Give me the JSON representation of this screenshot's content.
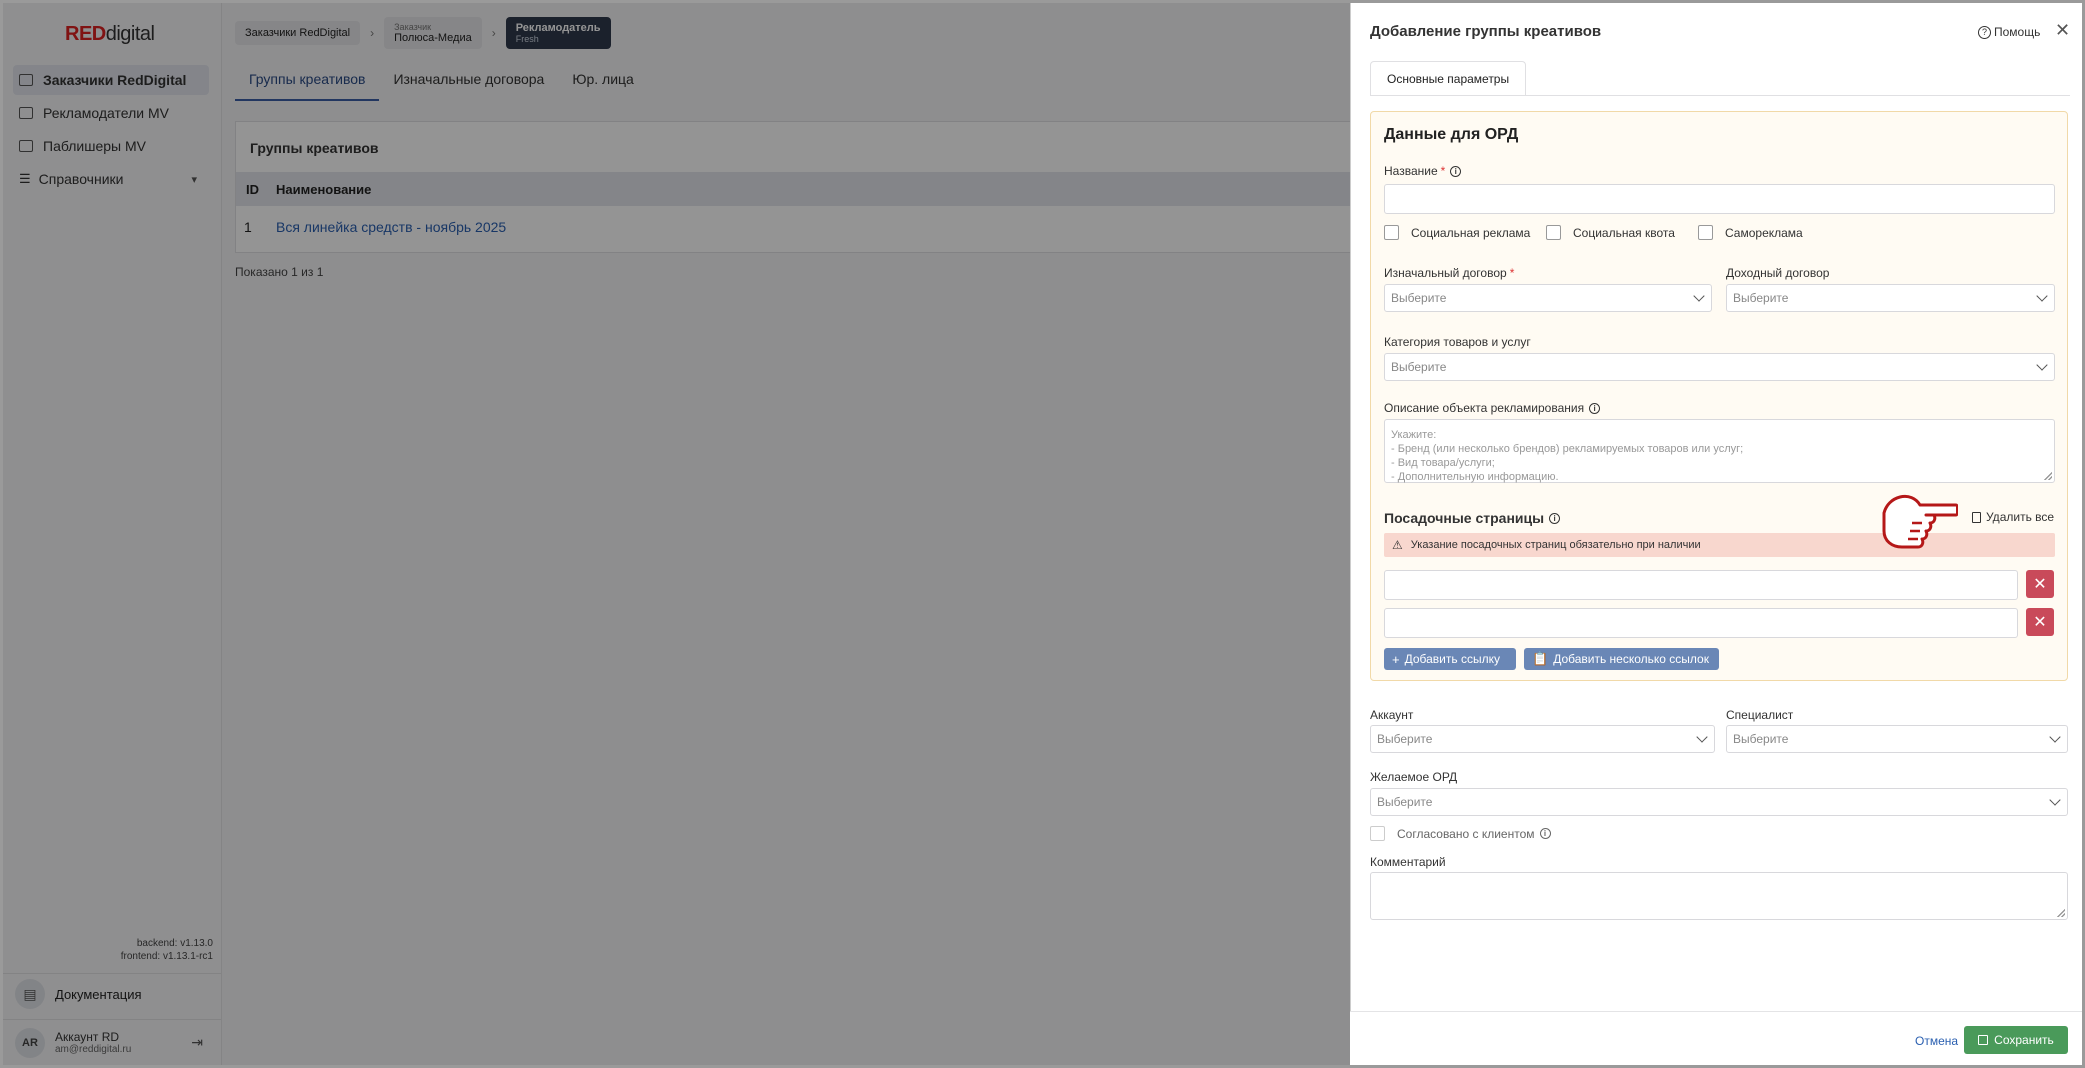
{
  "brand": {
    "red": "RED",
    "rest": "digital",
    "accent": "#dd2222"
  },
  "sidebar": {
    "items": [
      {
        "label": "Заказчики RedDigital",
        "icon": "id-card-icon"
      },
      {
        "label": "Рекламодатели MV",
        "icon": "id-card-icon"
      },
      {
        "label": "Паблишеры MV",
        "icon": "id-card-icon"
      },
      {
        "label": "Справочники",
        "icon": "list-icon"
      }
    ],
    "backend_version": "backend: v1.13.0",
    "frontend_version": "frontend: v1.13.1-rc1",
    "docs_label": "Документация",
    "user": {
      "initials": "AR",
      "name": "Аккаунт RD",
      "email": "am@reddigital.ru"
    }
  },
  "breadcrumbs": {
    "first": "Заказчики RedDigital",
    "second_caption": "Заказчик",
    "second_value": "Полюса-Медиа",
    "third_caption": "Рекламодатель",
    "third_value": "Fresh"
  },
  "tabs": [
    "Группы креативов",
    "Изначальные договора",
    "Юр. лица"
  ],
  "table": {
    "title": "Группы креативов",
    "columns": [
      "ID",
      "Наименование"
    ],
    "rows": [
      {
        "id": "1",
        "name": "Вся линейка средств - ноябрь 2025"
      }
    ],
    "shown": "Показано 1 из 1"
  },
  "drawer": {
    "title": "Добавление группы креативов",
    "help": "Помощь",
    "tab": "Основные параметры",
    "ord": {
      "title": "Данные для ОРД",
      "name_label": "Название",
      "checkboxes": [
        "Социальная реклама",
        "Социальная квота",
        "Самореклама"
      ],
      "initial_contract_label": "Изначальный договор",
      "income_contract_label": "Доходный договор",
      "category_label": "Категория товаров и услуг",
      "select_placeholder": "Выберите",
      "description_label": "Описание объекта рекламирования",
      "description_placeholder": "Укажите:\n- Бренд (или несколько брендов) рекламируемых товаров или услуг;\n- Вид товара/услуги;\n- Дополнительную информацию.",
      "landing_title": "Посадочные страницы",
      "delete_all": "Удалить все",
      "landing_warning": "Указание посадочных страниц обязательно при наличии",
      "add_link": "Добавить ссылку",
      "add_many_links": "Добавить несколько ссылок"
    },
    "account_label": "Аккаунт",
    "specialist_label": "Специалист",
    "desired_ord_label": "Желаемое ОРД",
    "agreed_label": "Согласовано с клиентом",
    "comment_label": "Комментарий",
    "cancel": "Отмена",
    "save": "Сохранить"
  }
}
